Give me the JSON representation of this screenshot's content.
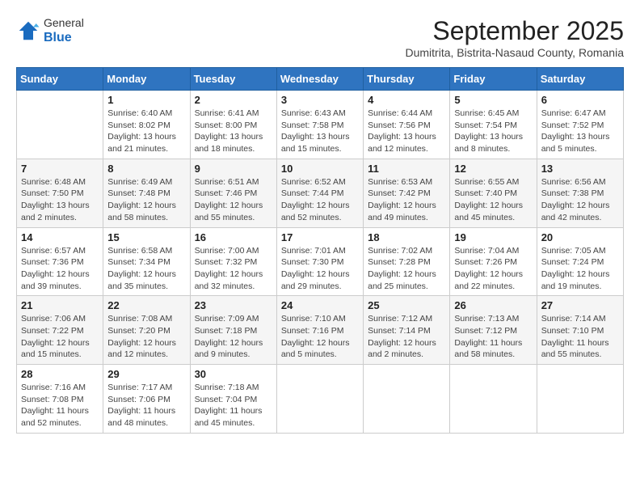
{
  "logo": {
    "general": "General",
    "blue": "Blue"
  },
  "title": "September 2025",
  "subtitle": "Dumitrita, Bistrita-Nasaud County, Romania",
  "headers": [
    "Sunday",
    "Monday",
    "Tuesday",
    "Wednesday",
    "Thursday",
    "Friday",
    "Saturday"
  ],
  "weeks": [
    [
      {
        "day": "",
        "sunrise": "",
        "sunset": "",
        "daylight": ""
      },
      {
        "day": "1",
        "sunrise": "Sunrise: 6:40 AM",
        "sunset": "Sunset: 8:02 PM",
        "daylight": "Daylight: 13 hours and 21 minutes."
      },
      {
        "day": "2",
        "sunrise": "Sunrise: 6:41 AM",
        "sunset": "Sunset: 8:00 PM",
        "daylight": "Daylight: 13 hours and 18 minutes."
      },
      {
        "day": "3",
        "sunrise": "Sunrise: 6:43 AM",
        "sunset": "Sunset: 7:58 PM",
        "daylight": "Daylight: 13 hours and 15 minutes."
      },
      {
        "day": "4",
        "sunrise": "Sunrise: 6:44 AM",
        "sunset": "Sunset: 7:56 PM",
        "daylight": "Daylight: 13 hours and 12 minutes."
      },
      {
        "day": "5",
        "sunrise": "Sunrise: 6:45 AM",
        "sunset": "Sunset: 7:54 PM",
        "daylight": "Daylight: 13 hours and 8 minutes."
      },
      {
        "day": "6",
        "sunrise": "Sunrise: 6:47 AM",
        "sunset": "Sunset: 7:52 PM",
        "daylight": "Daylight: 13 hours and 5 minutes."
      }
    ],
    [
      {
        "day": "7",
        "sunrise": "Sunrise: 6:48 AM",
        "sunset": "Sunset: 7:50 PM",
        "daylight": "Daylight: 13 hours and 2 minutes."
      },
      {
        "day": "8",
        "sunrise": "Sunrise: 6:49 AM",
        "sunset": "Sunset: 7:48 PM",
        "daylight": "Daylight: 12 hours and 58 minutes."
      },
      {
        "day": "9",
        "sunrise": "Sunrise: 6:51 AM",
        "sunset": "Sunset: 7:46 PM",
        "daylight": "Daylight: 12 hours and 55 minutes."
      },
      {
        "day": "10",
        "sunrise": "Sunrise: 6:52 AM",
        "sunset": "Sunset: 7:44 PM",
        "daylight": "Daylight: 12 hours and 52 minutes."
      },
      {
        "day": "11",
        "sunrise": "Sunrise: 6:53 AM",
        "sunset": "Sunset: 7:42 PM",
        "daylight": "Daylight: 12 hours and 49 minutes."
      },
      {
        "day": "12",
        "sunrise": "Sunrise: 6:55 AM",
        "sunset": "Sunset: 7:40 PM",
        "daylight": "Daylight: 12 hours and 45 minutes."
      },
      {
        "day": "13",
        "sunrise": "Sunrise: 6:56 AM",
        "sunset": "Sunset: 7:38 PM",
        "daylight": "Daylight: 12 hours and 42 minutes."
      }
    ],
    [
      {
        "day": "14",
        "sunrise": "Sunrise: 6:57 AM",
        "sunset": "Sunset: 7:36 PM",
        "daylight": "Daylight: 12 hours and 39 minutes."
      },
      {
        "day": "15",
        "sunrise": "Sunrise: 6:58 AM",
        "sunset": "Sunset: 7:34 PM",
        "daylight": "Daylight: 12 hours and 35 minutes."
      },
      {
        "day": "16",
        "sunrise": "Sunrise: 7:00 AM",
        "sunset": "Sunset: 7:32 PM",
        "daylight": "Daylight: 12 hours and 32 minutes."
      },
      {
        "day": "17",
        "sunrise": "Sunrise: 7:01 AM",
        "sunset": "Sunset: 7:30 PM",
        "daylight": "Daylight: 12 hours and 29 minutes."
      },
      {
        "day": "18",
        "sunrise": "Sunrise: 7:02 AM",
        "sunset": "Sunset: 7:28 PM",
        "daylight": "Daylight: 12 hours and 25 minutes."
      },
      {
        "day": "19",
        "sunrise": "Sunrise: 7:04 AM",
        "sunset": "Sunset: 7:26 PM",
        "daylight": "Daylight: 12 hours and 22 minutes."
      },
      {
        "day": "20",
        "sunrise": "Sunrise: 7:05 AM",
        "sunset": "Sunset: 7:24 PM",
        "daylight": "Daylight: 12 hours and 19 minutes."
      }
    ],
    [
      {
        "day": "21",
        "sunrise": "Sunrise: 7:06 AM",
        "sunset": "Sunset: 7:22 PM",
        "daylight": "Daylight: 12 hours and 15 minutes."
      },
      {
        "day": "22",
        "sunrise": "Sunrise: 7:08 AM",
        "sunset": "Sunset: 7:20 PM",
        "daylight": "Daylight: 12 hours and 12 minutes."
      },
      {
        "day": "23",
        "sunrise": "Sunrise: 7:09 AM",
        "sunset": "Sunset: 7:18 PM",
        "daylight": "Daylight: 12 hours and 9 minutes."
      },
      {
        "day": "24",
        "sunrise": "Sunrise: 7:10 AM",
        "sunset": "Sunset: 7:16 PM",
        "daylight": "Daylight: 12 hours and 5 minutes."
      },
      {
        "day": "25",
        "sunrise": "Sunrise: 7:12 AM",
        "sunset": "Sunset: 7:14 PM",
        "daylight": "Daylight: 12 hours and 2 minutes."
      },
      {
        "day": "26",
        "sunrise": "Sunrise: 7:13 AM",
        "sunset": "Sunset: 7:12 PM",
        "daylight": "Daylight: 11 hours and 58 minutes."
      },
      {
        "day": "27",
        "sunrise": "Sunrise: 7:14 AM",
        "sunset": "Sunset: 7:10 PM",
        "daylight": "Daylight: 11 hours and 55 minutes."
      }
    ],
    [
      {
        "day": "28",
        "sunrise": "Sunrise: 7:16 AM",
        "sunset": "Sunset: 7:08 PM",
        "daylight": "Daylight: 11 hours and 52 minutes."
      },
      {
        "day": "29",
        "sunrise": "Sunrise: 7:17 AM",
        "sunset": "Sunset: 7:06 PM",
        "daylight": "Daylight: 11 hours and 48 minutes."
      },
      {
        "day": "30",
        "sunrise": "Sunrise: 7:18 AM",
        "sunset": "Sunset: 7:04 PM",
        "daylight": "Daylight: 11 hours and 45 minutes."
      },
      {
        "day": "",
        "sunrise": "",
        "sunset": "",
        "daylight": ""
      },
      {
        "day": "",
        "sunrise": "",
        "sunset": "",
        "daylight": ""
      },
      {
        "day": "",
        "sunrise": "",
        "sunset": "",
        "daylight": ""
      },
      {
        "day": "",
        "sunrise": "",
        "sunset": "",
        "daylight": ""
      }
    ]
  ]
}
